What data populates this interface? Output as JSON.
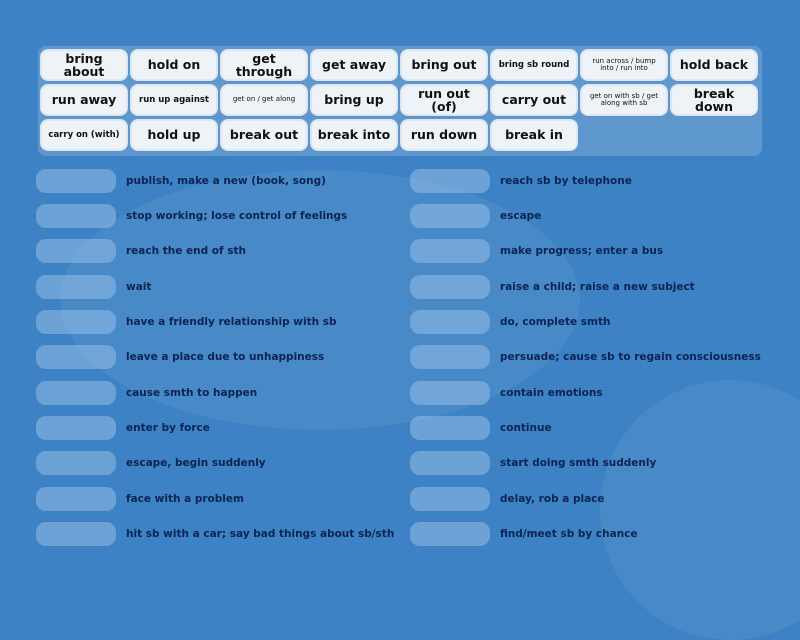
{
  "colors": {
    "background": "#3d82c4",
    "card": "#eef3f8",
    "definition_text": "#0b2452",
    "card_text": "#111111"
  },
  "cards": [
    [
      "bring about",
      "hold on",
      "get through",
      "get away",
      "bring out",
      "bring sb round",
      "run across / bump into / run into",
      "hold back"
    ],
    [
      "run away",
      "run up against",
      "get on / get along",
      "bring up",
      "run out (of)",
      "carry out",
      "get on with sb / get along with sb",
      "break down"
    ],
    [
      "carry on (with)",
      "hold up",
      "break out",
      "break into",
      "run down",
      "break in"
    ]
  ],
  "definitions_left": [
    "publish, make a new (book, song)",
    "stop working; lose control of feelings",
    "reach the end of sth",
    "wait",
    "have a friendly relationship with sb",
    "leave a place due to unhappiness",
    "cause smth to happen",
    "enter by force",
    "escape, begin suddenly",
    "face with a problem",
    "hit sb with a car; say bad things about sb/sth"
  ],
  "definitions_right": [
    "reach sb by telephone",
    "escape",
    "make progress; enter a bus",
    "raise a child; raise a new subject",
    "do, complete smth",
    "persuade; cause sb to regain consciousness",
    "contain emotions",
    "continue",
    "start doing smth suddenly",
    "delay, rob a place",
    "find/meet sb by chance"
  ]
}
